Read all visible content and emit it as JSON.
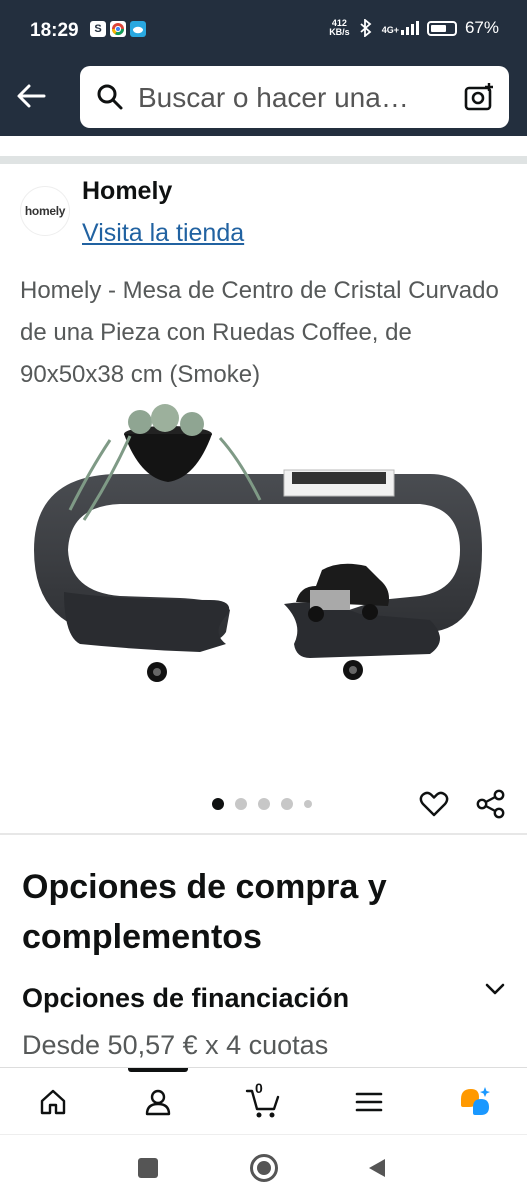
{
  "status": {
    "time": "18:29",
    "app_icons": [
      "S",
      "chrome-icon",
      "weather-icon"
    ],
    "network_speed_value": "412",
    "network_speed_unit": "KB/s",
    "signal_label": "4G+",
    "battery": "67%",
    "battery_level": 0.67
  },
  "header": {
    "search_placeholder": "Buscar o hacer una…"
  },
  "store": {
    "logo_text": "homely",
    "name": "Homely",
    "link": "Visita la tienda"
  },
  "product": {
    "title": "Homely - Mesa de Centro de Cristal Curvado de una Pieza con Ruedas Coffee, de 90x50x38 cm (Smoke)",
    "carousel_dots": 5,
    "carousel_active": 0
  },
  "options": {
    "heading": "Opciones de compra y complementos",
    "financing_title": "Opciones de financiación",
    "financing_subtitle": "Desde 50,57 € x 4 cuotas"
  },
  "nav": {
    "items": [
      "home-icon",
      "account-icon",
      "cart-icon",
      "menu-icon",
      "rufus-icon"
    ],
    "active": "account-icon",
    "cart_count": "0"
  },
  "colors": {
    "header_bg": "#232f3e",
    "link": "#2162a1",
    "accent": "#ff9900"
  }
}
